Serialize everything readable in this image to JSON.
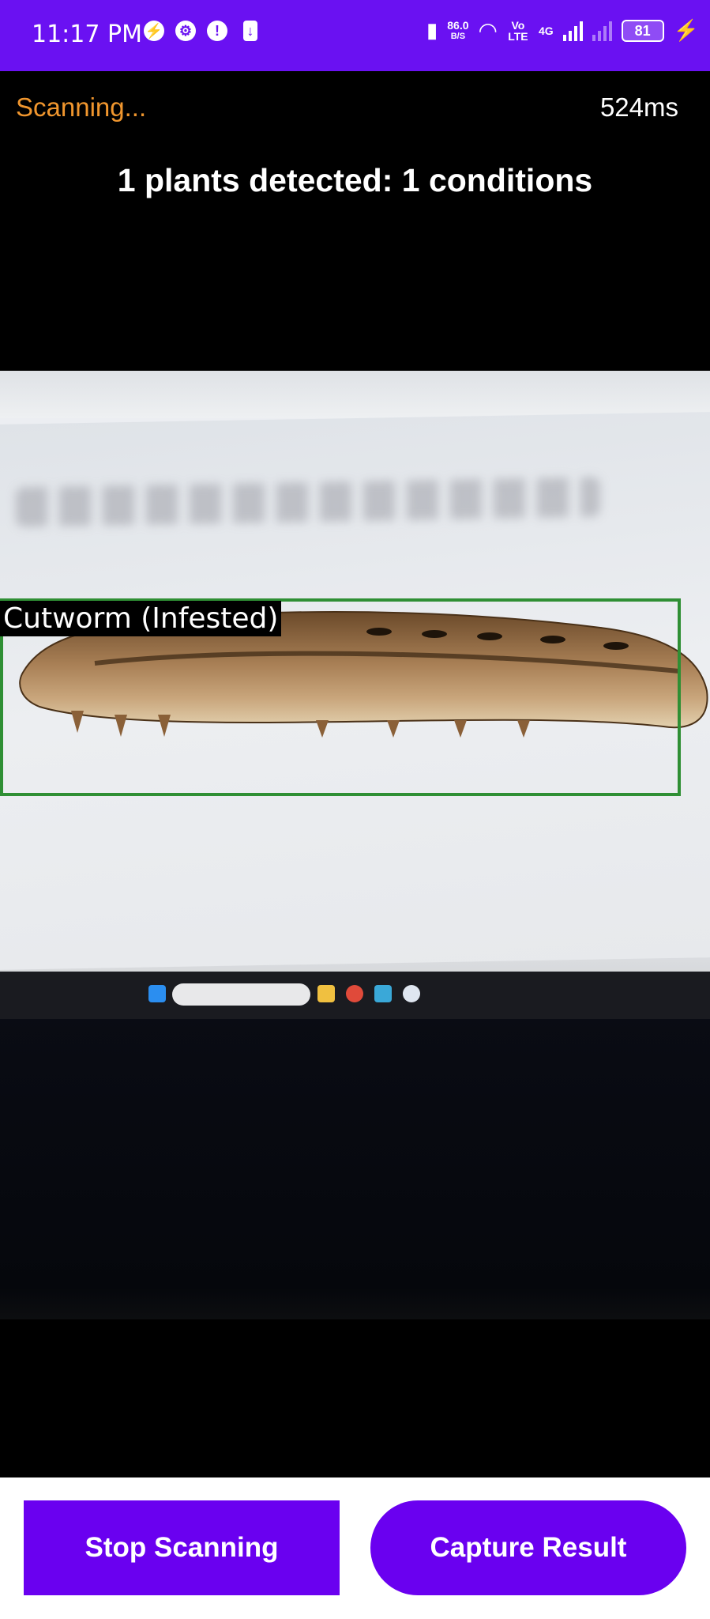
{
  "statusbar": {
    "time": "11:17 PM",
    "icons_left": [
      "messenger-icon",
      "settings-icon",
      "alert-icon",
      "download-icon"
    ],
    "net_speed_value": "86.0",
    "net_speed_unit": "B/S",
    "volte": "Vo LTE",
    "network": "4G",
    "battery": "81"
  },
  "scan": {
    "status": "Scanning...",
    "latency": "524ms",
    "summary": "1 plants detected: 1 conditions"
  },
  "detection": {
    "label": "Cutworm (Infested)"
  },
  "buttons": {
    "stop": "Stop Scanning",
    "capture": "Capture Result"
  },
  "colors": {
    "accent": "#6a00f0",
    "status_text": "#f0962e",
    "box": "#2f8f34"
  }
}
